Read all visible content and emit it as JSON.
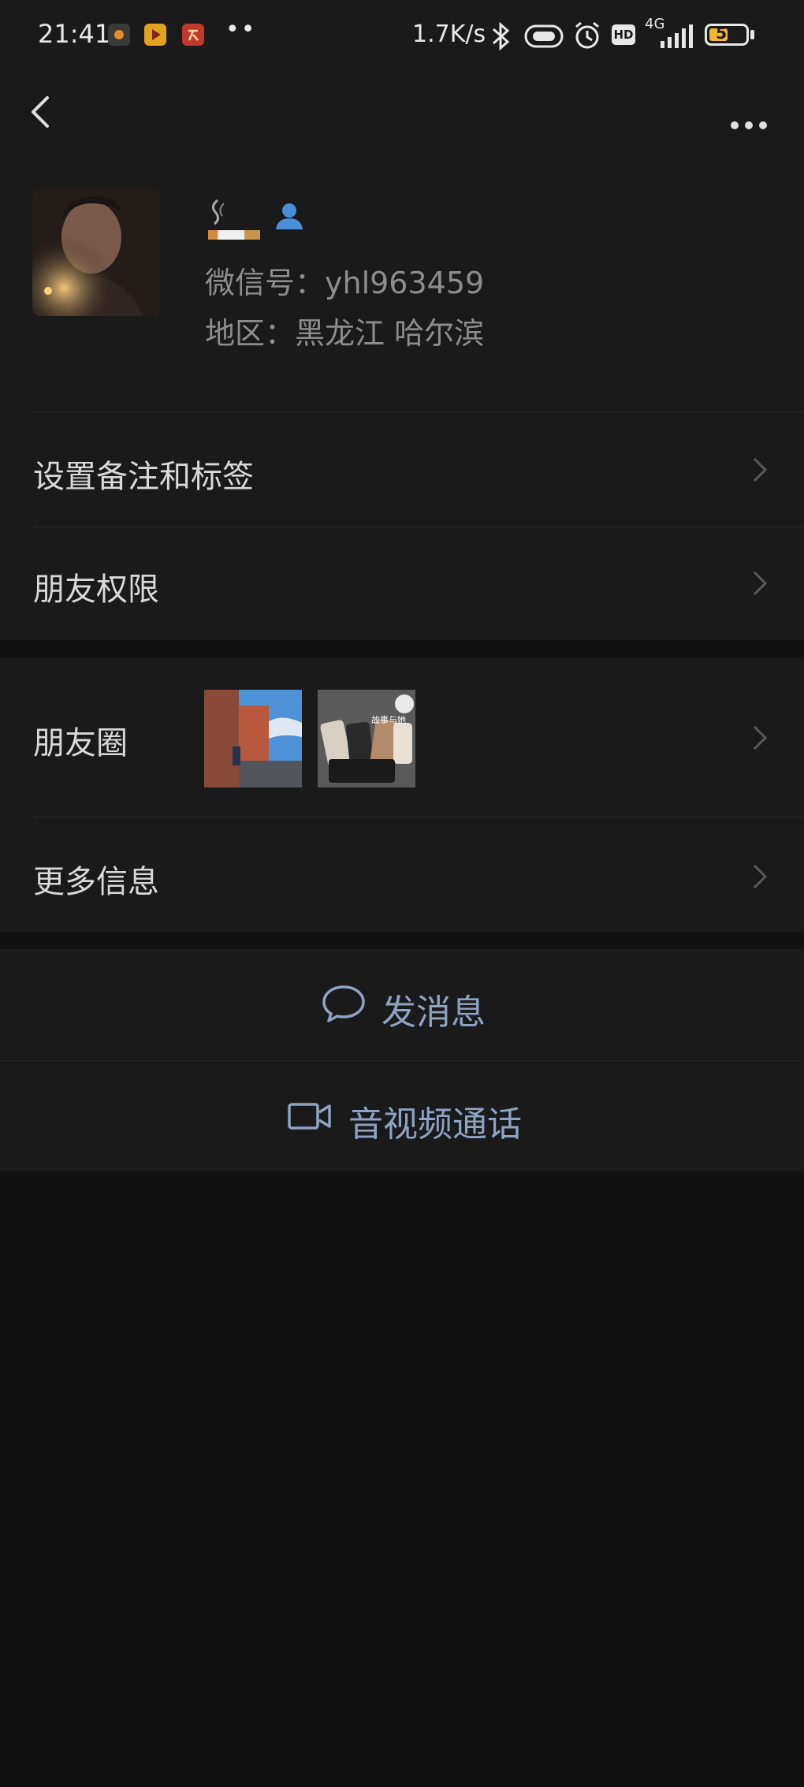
{
  "status_bar": {
    "time": "21:41",
    "notification_icons": [
      "app-icon-orange-dot",
      "app-icon-orange-play",
      "app-icon-red"
    ],
    "more_dots": "••",
    "net_speed": "1.7K/s",
    "hd_label": "HD",
    "network_label": "4G",
    "battery": "52",
    "battery_level": 0.52
  },
  "profile": {
    "wechat_id": "微信号：yhl963459",
    "region": "地区：黑龙江  哈尔滨"
  },
  "menu": {
    "remark_tags": "设置备注和标签",
    "permissions": "朋友权限",
    "moments": "朋友圈",
    "more_info": "更多信息"
  },
  "moments_thumb_text": "故事与她",
  "actions": {
    "send_message": "发消息",
    "call": "音视频通话"
  },
  "colors": {
    "background": "#111111",
    "surface": "#1a1a1a",
    "accent": "#8ea3c2",
    "muted_text": "#8d8d8d"
  }
}
